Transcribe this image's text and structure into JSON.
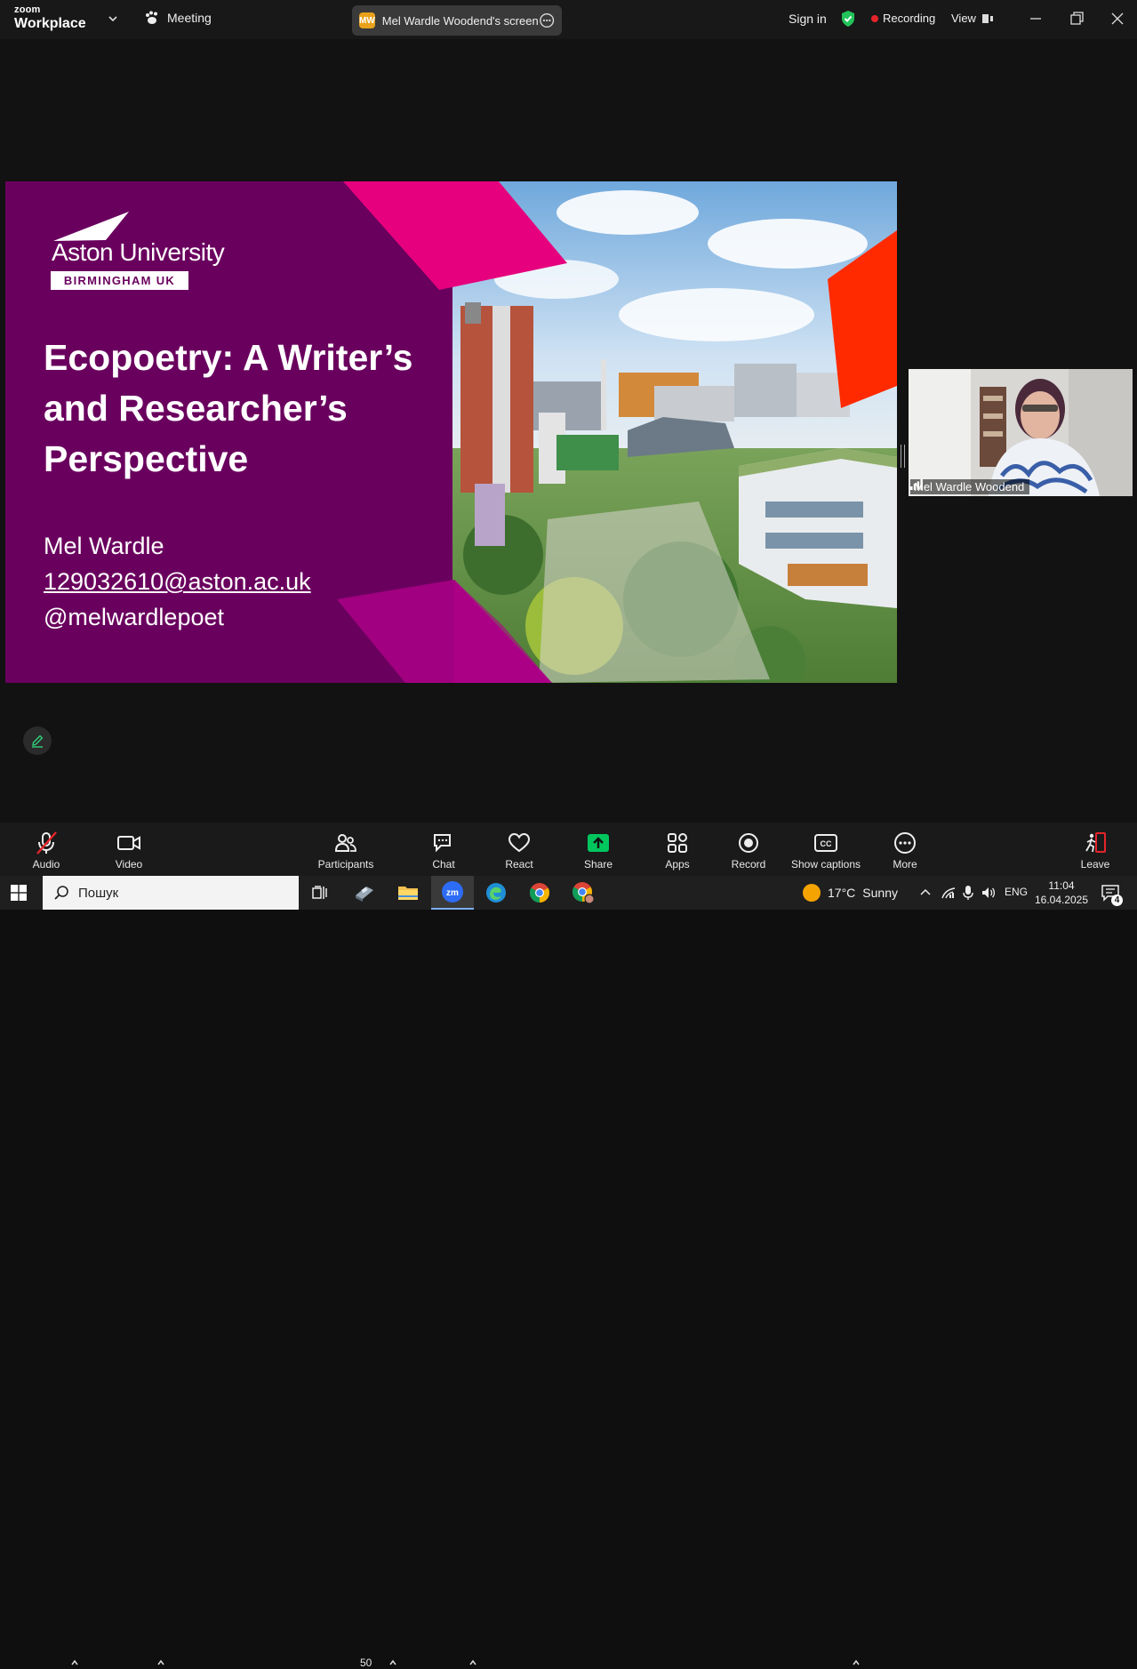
{
  "titlebar": {
    "brand_top": "zoom",
    "brand_bottom": "Workplace",
    "meeting_label": "Meeting",
    "screen_share_initials": "MW",
    "screen_share_label": "Mel Wardle Woodend's screen",
    "sign_in": "Sign in",
    "recording": "Recording",
    "view": "View"
  },
  "slide": {
    "logo_name": "Aston University",
    "logo_sub": "BIRMINGHAM UK",
    "title": "Ecopoetry: A Writer’s and Researcher’s Perspective",
    "author_name": "Mel Wardle",
    "author_email": "129032610@aston.ac.uk",
    "author_handle": "@melwardlepoet",
    "colors": {
      "purple": "#6a005e",
      "magenta": "#e6007e",
      "red": "#ff2a00"
    }
  },
  "video_tile": {
    "participant_name": "Mel Wardle Woodend"
  },
  "toolbar": {
    "audio": "Audio",
    "video": "Video",
    "participants": "Participants",
    "participants_count": "50",
    "chat": "Chat",
    "react": "React",
    "share": "Share",
    "apps": "Apps",
    "record": "Record",
    "show_captions": "Show captions",
    "more": "More",
    "leave": "Leave",
    "share_color": "#00c65e",
    "leave_color": "#e5242b"
  },
  "taskbar": {
    "search_placeholder": "Пошук",
    "weather_temp": "17°C",
    "weather_text": "Sunny",
    "language": "ENG",
    "time": "11:04",
    "date": "16.04.2025",
    "notifications": "4"
  }
}
